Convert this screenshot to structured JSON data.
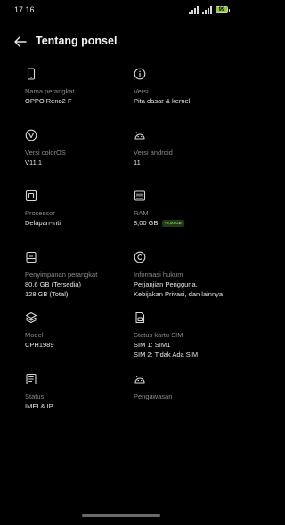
{
  "status_bar": {
    "time": "17.16",
    "battery_text": "99",
    "battery_level": 0.99,
    "battery_color": "#8fcf2b"
  },
  "header": {
    "title": "Tentang ponsel"
  },
  "items": [
    {
      "icon": "phone-icon",
      "label": "Nama perangkat",
      "value": "OPPO Reno2 F"
    },
    {
      "icon": "info-icon",
      "label": "Versi",
      "value": "Pita dasar & kernel"
    },
    {
      "icon": "coloros-icon",
      "label": "Versi colorOS",
      "value": "V11.1"
    },
    {
      "icon": "android-icon",
      "label": "Versi android",
      "value": "11"
    },
    {
      "icon": "processor-icon",
      "label": "Processor",
      "value": "Delapan-inti"
    },
    {
      "icon": "memory-icon",
      "label": "RAM",
      "value": "8,00 GB",
      "badge": "+5,00 GB"
    },
    {
      "icon": "storage-icon",
      "label": "Penyimpanan perangkat",
      "value": "80,6 GB (Tersedia)",
      "value2": "128 GB (Total)"
    },
    {
      "icon": "copyright-icon",
      "label": "Informasi hukum",
      "value": "Perjanjian Pengguna,",
      "value2": "Kebijakan Privasi, dan lainnya"
    },
    {
      "icon": "layers-icon",
      "label": "Model",
      "value": "CPH1989"
    },
    {
      "icon": "sim-card-icon",
      "label": "Status kartu SIM",
      "value": "SIM 1: SIM1",
      "value2": "SIM 2: Tidak Ada SIM"
    },
    {
      "icon": "document-icon",
      "label": "Status",
      "value": "IMEI & IP"
    },
    {
      "icon": "android-icon",
      "label": "Pengawasan",
      "value": ""
    }
  ]
}
